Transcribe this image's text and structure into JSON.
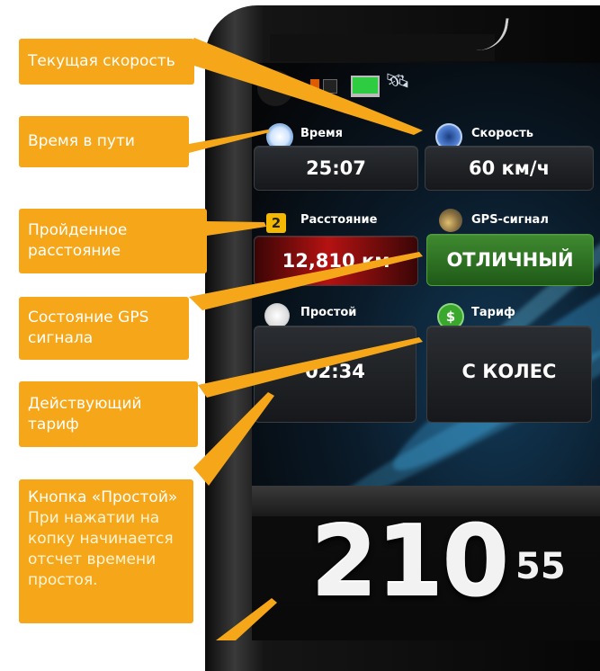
{
  "callouts": {
    "current_speed": "Текущая скорость",
    "travel_time": "Время в пути",
    "distance_line1": "Пройденное",
    "distance_line2": "расстояние",
    "gps_line1": "Состояние GPS",
    "gps_line2": "сигнала",
    "tariff_line1": "Действующий",
    "tariff_line2": "тариф",
    "idle_title": "Кнопка «Простой»",
    "idle_desc_1": "При нажатии на",
    "idle_desc_2": "копку начинается",
    "idle_desc_3": "отсчет времени",
    "idle_desc_4": "простоя."
  },
  "app": {
    "time": {
      "label": "Время",
      "value": "25:07"
    },
    "speed": {
      "label": "Скорость",
      "value": "60 км/ч"
    },
    "distance": {
      "label": "Расстояние",
      "badge": "2",
      "value": "12,810 км"
    },
    "gps": {
      "label": "GPS-сигнал",
      "value": "ОТЛИЧНЫЙ"
    },
    "idle": {
      "label": "Простой",
      "value": "02:34"
    },
    "tariff": {
      "label": "Тариф",
      "icon_text": "$",
      "value": "С КОЛЕС"
    },
    "fare": {
      "main": "210",
      "fraction": "55"
    }
  },
  "colors": {
    "callout_bg": "#f6a719",
    "distance_tile": "#b51212",
    "gps_tile": "#3f8a30",
    "accent_yellow": "#f5b800"
  },
  "icons": [
    "logo-icon",
    "battery-icon",
    "laptop-icon",
    "satellite-icon",
    "clock-icon",
    "speedometer-icon",
    "calendar-badge-icon",
    "satellite-dish-icon",
    "stopwatch-icon",
    "dollar-icon"
  ]
}
